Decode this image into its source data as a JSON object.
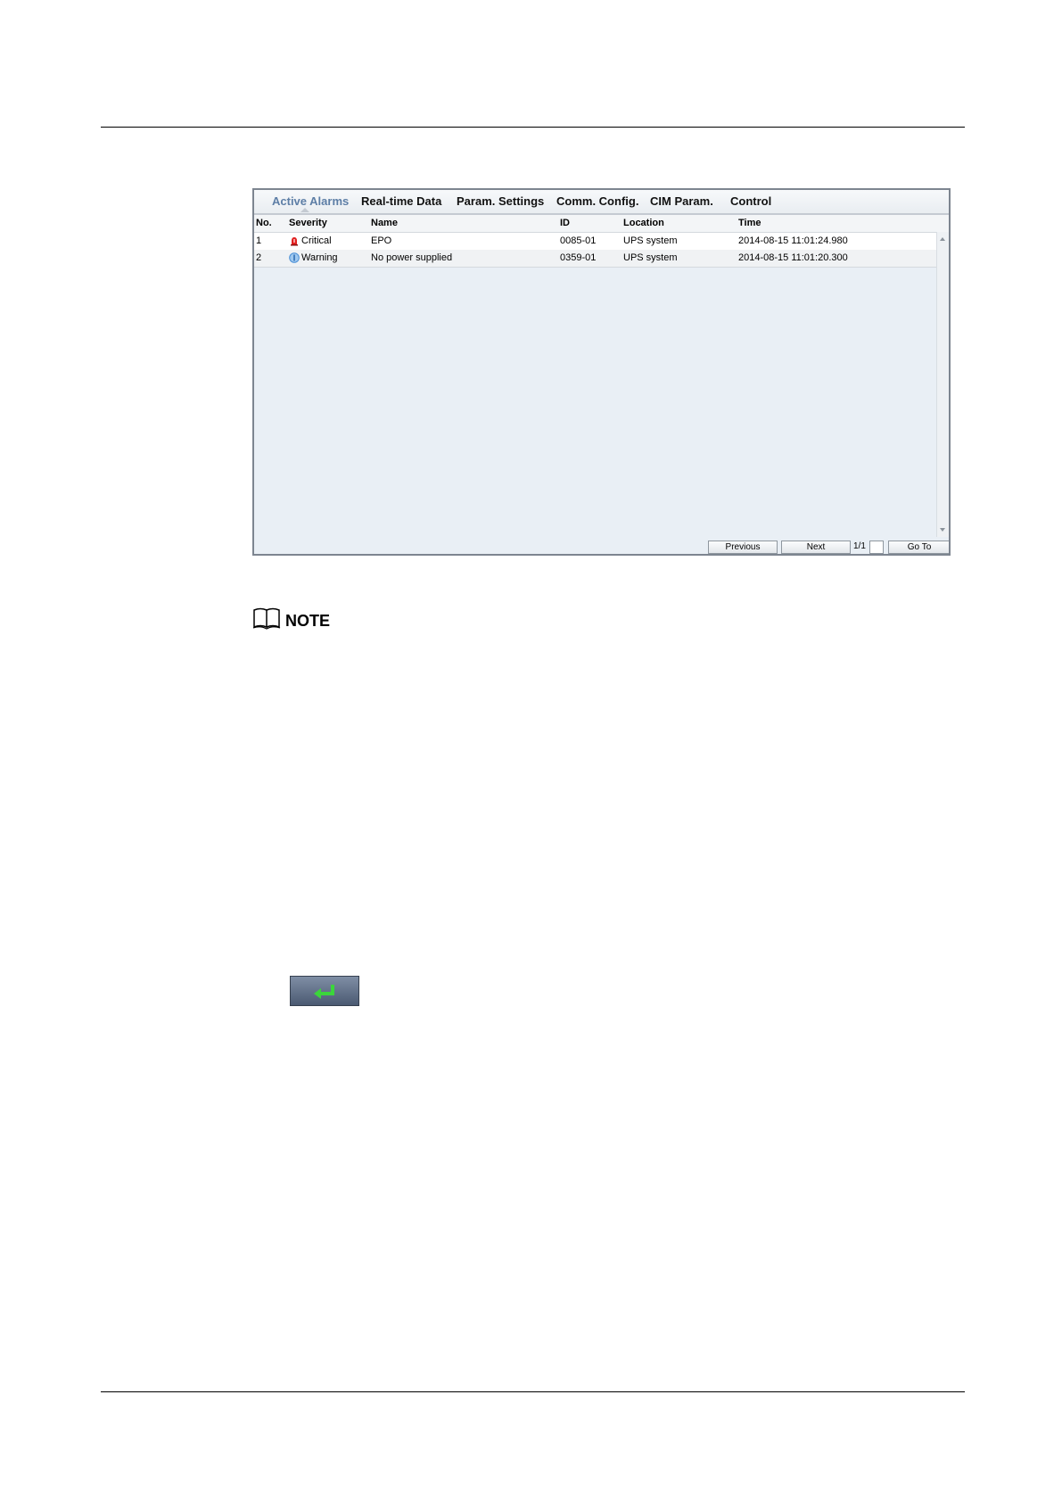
{
  "tabs": [
    {
      "label": "Active Alarms",
      "active": true
    },
    {
      "label": "Real-time Data",
      "active": false
    },
    {
      "label": "Param. Settings",
      "active": false
    },
    {
      "label": "Comm. Config.",
      "active": false
    },
    {
      "label": "CIM Param.",
      "active": false
    },
    {
      "label": "Control",
      "active": false
    }
  ],
  "table": {
    "columns": [
      "No.",
      "Severity",
      "Name",
      "ID",
      "Location",
      "Time"
    ],
    "rows": [
      {
        "no": "1",
        "severity": "Critical",
        "severity_icon": "red-alarm-icon",
        "name": "EPO",
        "id": "0085-01",
        "location": "UPS system",
        "time": "2014-08-15 11:01:24.980"
      },
      {
        "no": "2",
        "severity": "Warning",
        "severity_icon": "blue-info-icon",
        "name": "No power supplied",
        "id": "0359-01",
        "location": "UPS system",
        "time": "2014-08-15 11:01:20.300"
      }
    ]
  },
  "pager": {
    "previous_label": "Previous",
    "next_label": "Next",
    "page_text": "1/1",
    "goto_label": "Go To",
    "goto_value": ""
  },
  "note": {
    "label": "NOTE",
    "icon": "book-icon"
  },
  "enter_button": {
    "icon": "enter-arrow-icon",
    "arrow_color": "#3bd63b"
  },
  "colors": {
    "active_tab": "#5d7ea6",
    "critical": "#e02020",
    "warning": "#4a8fd6"
  }
}
